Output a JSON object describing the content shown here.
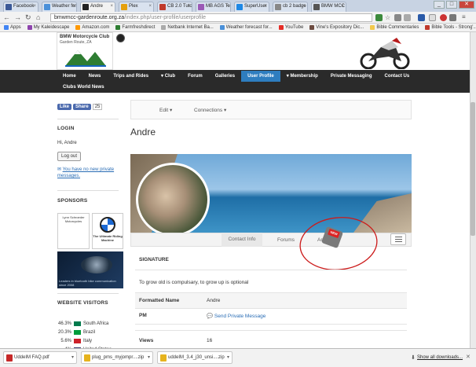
{
  "browser": {
    "tabs": [
      {
        "label": "Facebook",
        "color": "#3b5998"
      },
      {
        "label": "Weather fore",
        "color": "#4a90d9"
      },
      {
        "label": "Andre",
        "color": "#222222",
        "active": true
      },
      {
        "label": "Plex",
        "color": "#e5a00d"
      },
      {
        "label": "CB 2.0 Tutori",
        "color": "#c0392b"
      },
      {
        "label": "MB AGS Tex",
        "color": "#9b59b6"
      },
      {
        "label": "SuperUser",
        "color": "#1e88e5"
      },
      {
        "label": "cb 2 badge h",
        "color": "#888888"
      },
      {
        "label": "BMW MCC G",
        "color": "#555555"
      }
    ],
    "url_host": "bmwmcc-gardenroute.org.za",
    "url_path": "/index.php/user-profile/userprofile",
    "bookmarks": [
      "Apps",
      "My Kaleidescape",
      "Amazon.com",
      "Farmfreshdirect",
      "Netbank Internet Ba...",
      "Weather forecast for...",
      "YouTube",
      "Vine's Expository Dic...",
      "Bible Commentaries",
      "Bible Tools - Strong'..."
    ]
  },
  "site": {
    "club_name": "BMW Motorcycle Club",
    "club_sub": "Garden Route, ZA",
    "nav_row1": [
      "Home",
      "News",
      "Trips and Rides",
      "▾ Club",
      "Forum",
      "Galleries",
      "User Profile",
      "▾ Membership",
      "Private Messaging",
      "Contact Us"
    ],
    "nav_row2": [
      "Clubs World News"
    ],
    "active_nav": "User Profile"
  },
  "sidebar": {
    "like": "Like",
    "share": "Share",
    "share_count": "25",
    "login_title": "LOGIN",
    "greeting": "Hi, Andre",
    "logout": "Log out",
    "messages_link": "You have no new private messages.",
    "sponsors_title": "SPONSORS",
    "sponsor1": "Lynn Schroeder Motorcycles",
    "sponsor2": "The Ultimate Riding Machine",
    "sponsor3": "Leaders in bluetooth bike communication since 2008",
    "visitors_title": "WEBSITE VISITORS",
    "visitors": [
      {
        "pct": "46.3%",
        "country": "South Africa",
        "flag": "#007a4d"
      },
      {
        "pct": "20.3%",
        "country": "Brazil",
        "flag": "#009c3b"
      },
      {
        "pct": "5.6%",
        "country": "Italy",
        "flag": "#cd212a"
      },
      {
        "pct": "4%",
        "country": "United States",
        "flag": "#3c3b6e"
      }
    ]
  },
  "profile": {
    "edit_label": "Edit",
    "connections_label": "Connections",
    "name": "Andre",
    "tabs": [
      "Contact Info",
      "Forums",
      "Ar"
    ],
    "signature_title": "SIGNATURE",
    "signature_text": "To grow old is compulsary, to grow up is optional",
    "formatted_name_label": "Formatted Name",
    "formatted_name_value": "Andre",
    "pm_label": "PM",
    "pm_value": "Send Private Message",
    "views_label": "Views",
    "views_value": "16",
    "stamp_text": "NEW"
  },
  "downloads": {
    "items": [
      {
        "name": "UddeIM FAQ.pdf",
        "color": "#c62828"
      },
      {
        "name": "plug_pms_myjompr....zip",
        "color": "#e6b31e"
      },
      {
        "name": "uddeIM_3.4_j30_unsi....zip",
        "color": "#e6b31e"
      }
    ],
    "show_all": "Show all downloads..."
  }
}
